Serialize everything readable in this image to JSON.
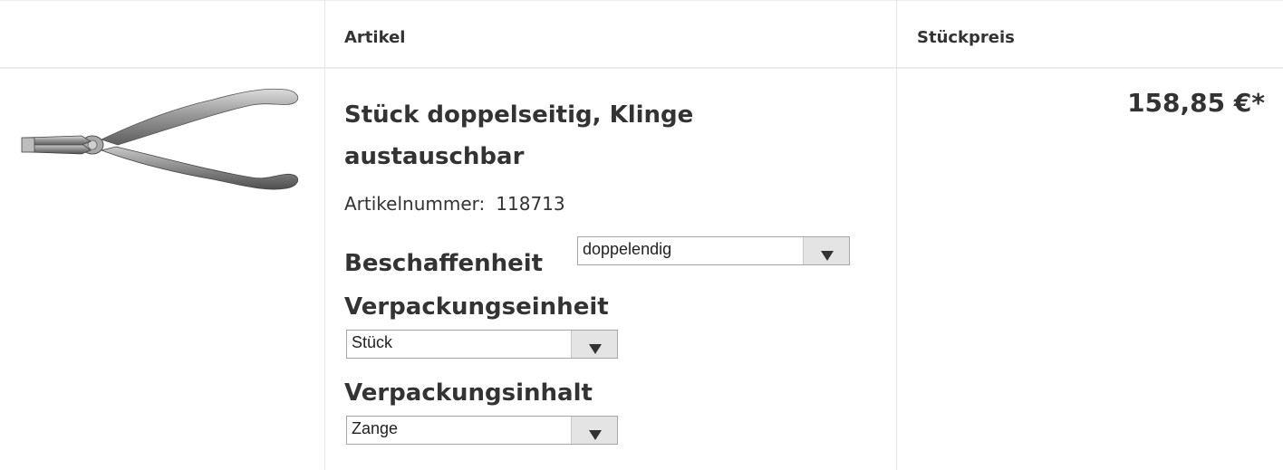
{
  "table": {
    "headers": {
      "image": "",
      "article": "Artikel",
      "unit_price": "Stückpreis"
    }
  },
  "product": {
    "title_line1": "Stück doppelseitig, Klinge",
    "title_line2": "austauschbar",
    "article_number_label": "Artikelnummer:",
    "article_number": "118713",
    "image_icon": "pliers-image",
    "price": "158,85 €*",
    "attributes": [
      {
        "label": "Beschaffenheit",
        "selected": "doppelendig"
      },
      {
        "label": "Verpackungseinheit",
        "selected": "Stück"
      },
      {
        "label": "Verpackungsinhalt",
        "selected": "Zange"
      }
    ]
  },
  "colors": {
    "text": "#333333",
    "border": "#e6e6e6",
    "select_button": "#e4e4e4"
  }
}
